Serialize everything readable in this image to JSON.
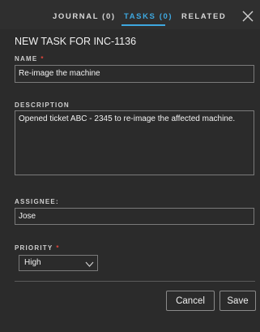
{
  "tabs": [
    {
      "label": "JOURNAL (0)"
    },
    {
      "label": "TASKS (0)"
    },
    {
      "label": "RELATED"
    }
  ],
  "active_tab_index": 1,
  "accent_color": "#3ea8e0",
  "required_color": "#e0463c",
  "form": {
    "title": "NEW TASK FOR  INC-1136",
    "name": {
      "label": "NAME",
      "required_mark": "*",
      "value": "Re-image the machine"
    },
    "description": {
      "label": "DESCRIPTION",
      "value": "Opened ticket  ABC - 2345 to re-image the affected machine."
    },
    "assignee": {
      "label": "ASSIGNEE:",
      "value": "Jose"
    },
    "priority": {
      "label": "PRIORITY",
      "required_mark": "*",
      "value": "High"
    }
  },
  "actions": {
    "cancel_label": "Cancel",
    "save_label": "Save"
  },
  "icons": {
    "close": "close-icon",
    "dropdown": "chevron-down-icon"
  }
}
